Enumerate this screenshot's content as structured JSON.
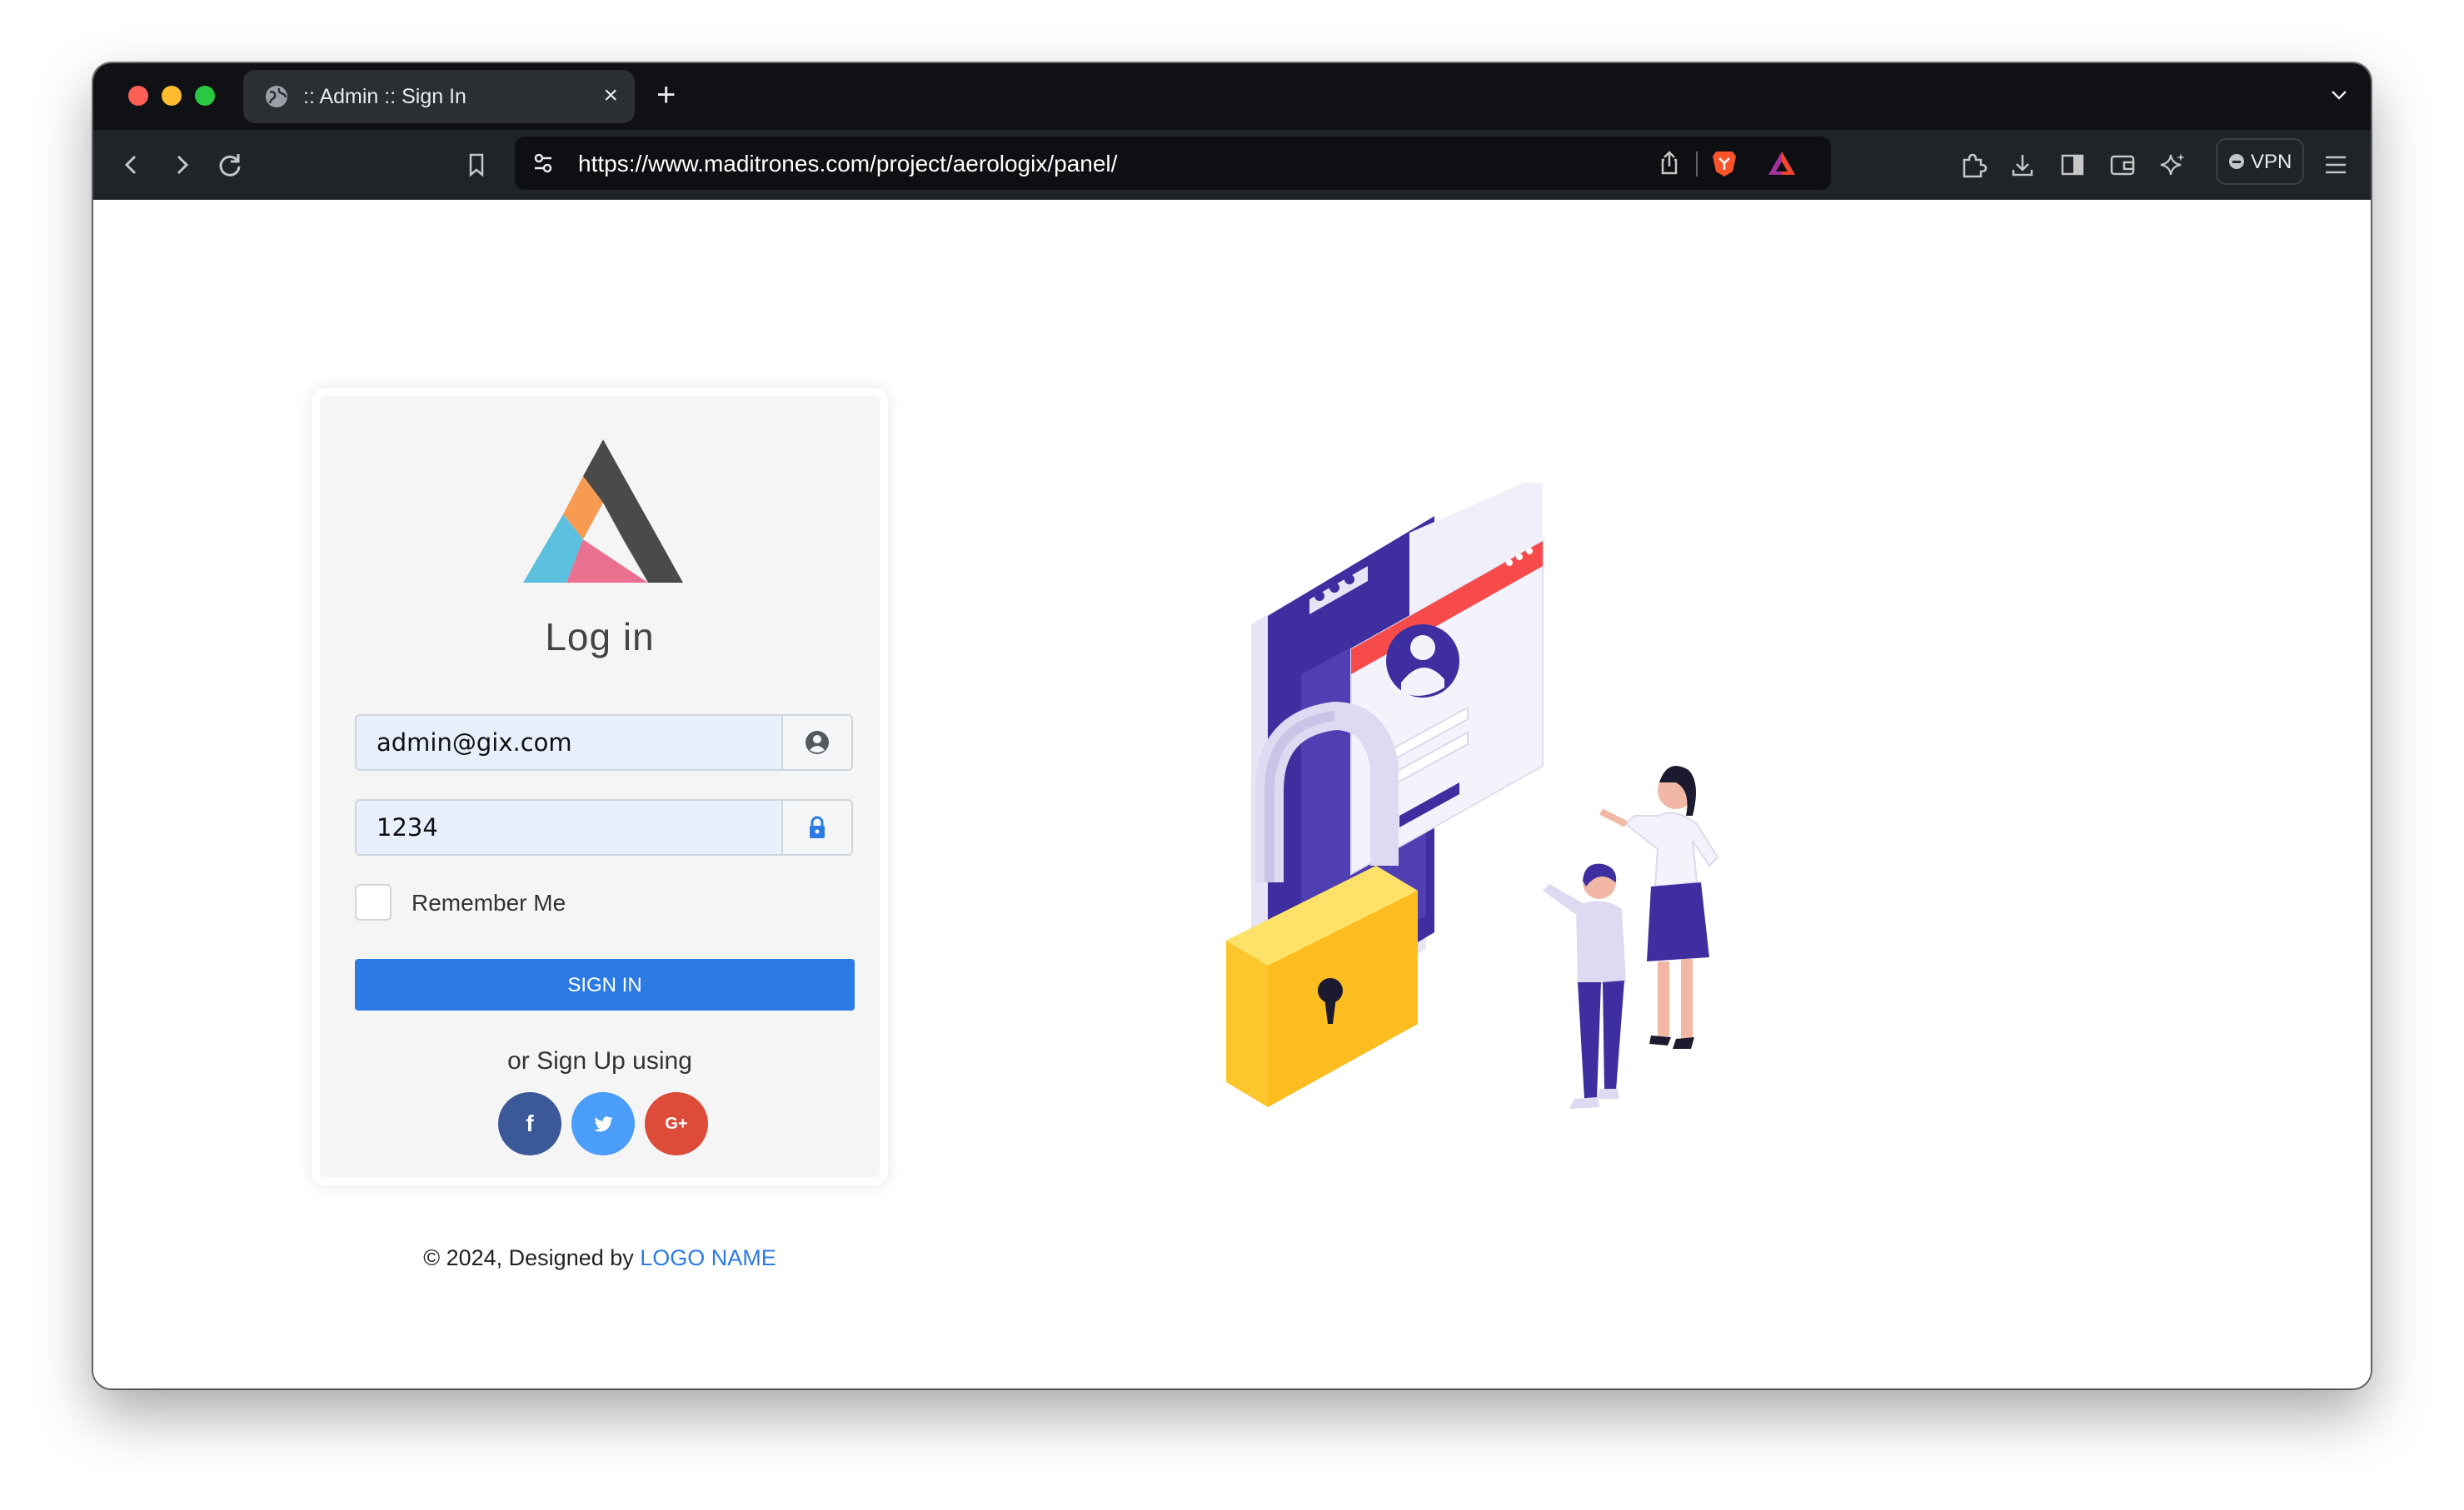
{
  "browser": {
    "tab_title": ":: Admin :: Sign In",
    "tab_close": "×",
    "new_tab": "+",
    "url": "https://www.maditrones.com/project/aerologix/panel/",
    "vpn_label": "VPN"
  },
  "login": {
    "title": "Log in",
    "email_value": "admin@gix.com",
    "password_value": "1234",
    "remember_label": "Remember Me",
    "signin_label": "SIGN IN",
    "signup_text": "or Sign Up using",
    "social": {
      "facebook": "f",
      "twitter": "t",
      "google": "G+"
    }
  },
  "footer": {
    "text": "© 2024, Designed by ",
    "link": "LOGO NAME"
  },
  "colors": {
    "primary": "#2c7be5",
    "facebook": "#3b5998",
    "twitter": "#4a9df8",
    "google": "#dd4b39",
    "lock_yellow": "#fcc72c",
    "illustration_purple": "#3f2ea0",
    "window_red": "#f74b4b"
  },
  "icons": {
    "email_addon": "user-circle-icon",
    "password_addon": "lock-icon",
    "tab_favicon": "globe-icon"
  }
}
